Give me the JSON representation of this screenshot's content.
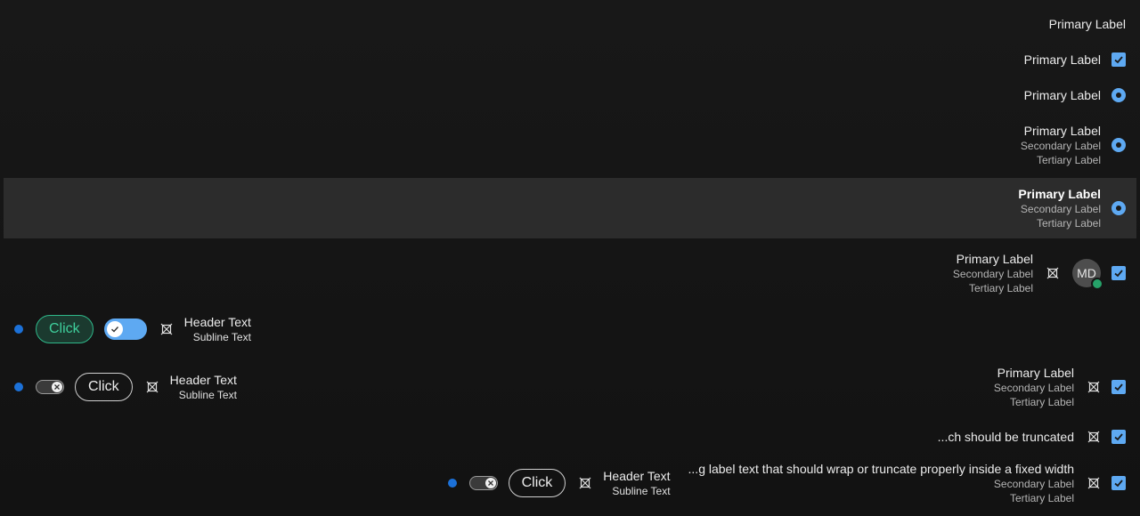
{
  "colors": {
    "background": "#151515",
    "selected_row": "#2c2c2c",
    "accent": "#5ea9f2",
    "status_dot": "#1c71d8",
    "presence": "#26a269",
    "green_button": "#3fcf9c"
  },
  "rows": {
    "r1": {
      "primary": "Primary Label"
    },
    "r2": {
      "primary": "Primary Label",
      "control": "checkbox"
    },
    "r3": {
      "primary": "Primary Label",
      "control": "radio"
    },
    "r4": {
      "primary": "Primary Label",
      "secondary": "Secondary Label",
      "tertiary": "Tertiary Label",
      "control": "radio"
    },
    "r5": {
      "primary": "Primary Label",
      "secondary": "Secondary Label",
      "tertiary": "Tertiary Label",
      "control": "radio",
      "selected": true
    },
    "r6": {
      "primary": "Primary Label",
      "secondary": "Secondary Label",
      "tertiary": "Tertiary Label",
      "icon": "x-mark-icon",
      "avatar_initials": "MD",
      "control": "checkbox"
    },
    "r7": {
      "button": "Click",
      "toggle": "on",
      "icon": "x-mark-icon",
      "header": "Header Text",
      "subline": "Subline Text"
    },
    "r8": {
      "left": {
        "toggle": "off",
        "button": "Click",
        "icon": "x-mark-icon",
        "header": "Header Text",
        "subline": "Subline Text"
      },
      "right": {
        "primary": "Primary Label",
        "secondary": "Secondary Label",
        "tertiary": "Tertiary Label",
        "icon": "x-mark-icon",
        "control": "checkbox"
      }
    },
    "r9": {
      "primary": "...ch should be truncated",
      "icon": "x-mark-icon",
      "control": "checkbox"
    },
    "r10": {
      "left": {
        "toggle": "off",
        "button": "Click",
        "icon": "x-mark-icon",
        "header": "Header Text",
        "subline": "Subline Text"
      },
      "primary": "...g label text that should wrap or truncate properly inside a fixed width",
      "secondary": "Secondary Label",
      "tertiary": "Tertiary Label",
      "icon": "x-mark-icon",
      "control": "checkbox"
    }
  }
}
